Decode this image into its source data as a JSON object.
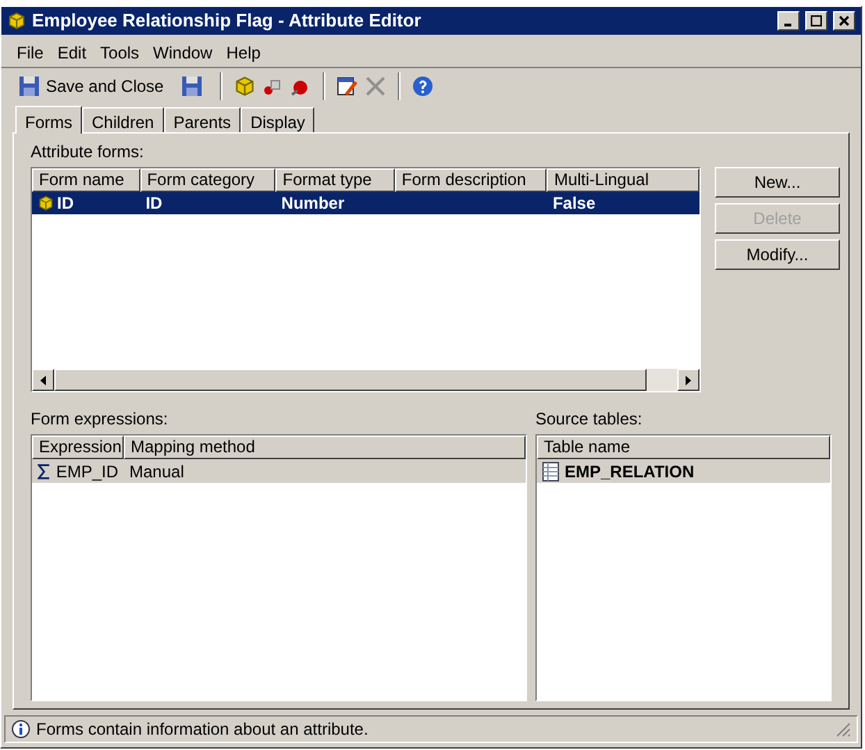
{
  "window": {
    "title": "Employee Relationship Flag - Attribute Editor"
  },
  "menu": [
    "File",
    "Edit",
    "Tools",
    "Window",
    "Help"
  ],
  "toolbar": {
    "save_label": "Save and Close"
  },
  "tabs": [
    {
      "label": "Forms",
      "selected": true
    },
    {
      "label": "Children",
      "selected": false
    },
    {
      "label": "Parents",
      "selected": false
    },
    {
      "label": "Display",
      "selected": false
    }
  ],
  "attribute_forms": {
    "label": "Attribute forms:",
    "columns": [
      "Form name",
      "Form category",
      "Format type",
      "Form description",
      "Multi-Lingual"
    ],
    "rows": [
      {
        "cells": [
          "ID",
          "ID",
          "Number",
          "",
          "False"
        ],
        "selected": true
      }
    ]
  },
  "buttons": [
    {
      "label": "New...",
      "disabled": false
    },
    {
      "label": "Delete",
      "disabled": true
    },
    {
      "label": "Modify...",
      "disabled": false
    }
  ],
  "form_expressions": {
    "label": "Form expressions:",
    "columns": [
      "Expression",
      "Mapping method"
    ],
    "rows": [
      {
        "cells": [
          "EMP_ID",
          "Manual"
        ],
        "selected": true
      }
    ]
  },
  "source_tables": {
    "label": "Source tables:",
    "columns": [
      "Table name"
    ],
    "rows": [
      {
        "cells": [
          "EMP_RELATION"
        ],
        "selected": true
      }
    ]
  },
  "status_bar": "Forms contain information about an attribute."
}
